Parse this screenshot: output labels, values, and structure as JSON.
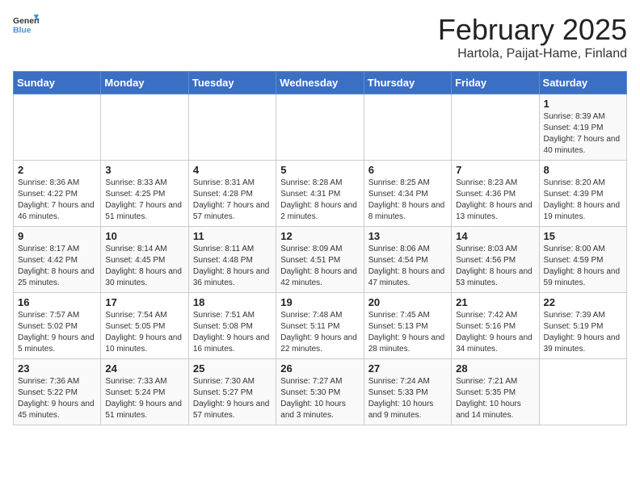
{
  "header": {
    "logo_general": "General",
    "logo_blue": "Blue",
    "month_year": "February 2025",
    "location": "Hartola, Paijat-Hame, Finland"
  },
  "days_of_week": [
    "Sunday",
    "Monday",
    "Tuesday",
    "Wednesday",
    "Thursday",
    "Friday",
    "Saturday"
  ],
  "weeks": [
    [
      {
        "day": "",
        "info": ""
      },
      {
        "day": "",
        "info": ""
      },
      {
        "day": "",
        "info": ""
      },
      {
        "day": "",
        "info": ""
      },
      {
        "day": "",
        "info": ""
      },
      {
        "day": "",
        "info": ""
      },
      {
        "day": "1",
        "info": "Sunrise: 8:39 AM\nSunset: 4:19 PM\nDaylight: 7 hours and 40 minutes."
      }
    ],
    [
      {
        "day": "2",
        "info": "Sunrise: 8:36 AM\nSunset: 4:22 PM\nDaylight: 7 hours and 46 minutes."
      },
      {
        "day": "3",
        "info": "Sunrise: 8:33 AM\nSunset: 4:25 PM\nDaylight: 7 hours and 51 minutes."
      },
      {
        "day": "4",
        "info": "Sunrise: 8:31 AM\nSunset: 4:28 PM\nDaylight: 7 hours and 57 minutes."
      },
      {
        "day": "5",
        "info": "Sunrise: 8:28 AM\nSunset: 4:31 PM\nDaylight: 8 hours and 2 minutes."
      },
      {
        "day": "6",
        "info": "Sunrise: 8:25 AM\nSunset: 4:34 PM\nDaylight: 8 hours and 8 minutes."
      },
      {
        "day": "7",
        "info": "Sunrise: 8:23 AM\nSunset: 4:36 PM\nDaylight: 8 hours and 13 minutes."
      },
      {
        "day": "8",
        "info": "Sunrise: 8:20 AM\nSunset: 4:39 PM\nDaylight: 8 hours and 19 minutes."
      }
    ],
    [
      {
        "day": "9",
        "info": "Sunrise: 8:17 AM\nSunset: 4:42 PM\nDaylight: 8 hours and 25 minutes."
      },
      {
        "day": "10",
        "info": "Sunrise: 8:14 AM\nSunset: 4:45 PM\nDaylight: 8 hours and 30 minutes."
      },
      {
        "day": "11",
        "info": "Sunrise: 8:11 AM\nSunset: 4:48 PM\nDaylight: 8 hours and 36 minutes."
      },
      {
        "day": "12",
        "info": "Sunrise: 8:09 AM\nSunset: 4:51 PM\nDaylight: 8 hours and 42 minutes."
      },
      {
        "day": "13",
        "info": "Sunrise: 8:06 AM\nSunset: 4:54 PM\nDaylight: 8 hours and 47 minutes."
      },
      {
        "day": "14",
        "info": "Sunrise: 8:03 AM\nSunset: 4:56 PM\nDaylight: 8 hours and 53 minutes."
      },
      {
        "day": "15",
        "info": "Sunrise: 8:00 AM\nSunset: 4:59 PM\nDaylight: 8 hours and 59 minutes."
      }
    ],
    [
      {
        "day": "16",
        "info": "Sunrise: 7:57 AM\nSunset: 5:02 PM\nDaylight: 9 hours and 5 minutes."
      },
      {
        "day": "17",
        "info": "Sunrise: 7:54 AM\nSunset: 5:05 PM\nDaylight: 9 hours and 10 minutes."
      },
      {
        "day": "18",
        "info": "Sunrise: 7:51 AM\nSunset: 5:08 PM\nDaylight: 9 hours and 16 minutes."
      },
      {
        "day": "19",
        "info": "Sunrise: 7:48 AM\nSunset: 5:11 PM\nDaylight: 9 hours and 22 minutes."
      },
      {
        "day": "20",
        "info": "Sunrise: 7:45 AM\nSunset: 5:13 PM\nDaylight: 9 hours and 28 minutes."
      },
      {
        "day": "21",
        "info": "Sunrise: 7:42 AM\nSunset: 5:16 PM\nDaylight: 9 hours and 34 minutes."
      },
      {
        "day": "22",
        "info": "Sunrise: 7:39 AM\nSunset: 5:19 PM\nDaylight: 9 hours and 39 minutes."
      }
    ],
    [
      {
        "day": "23",
        "info": "Sunrise: 7:36 AM\nSunset: 5:22 PM\nDaylight: 9 hours and 45 minutes."
      },
      {
        "day": "24",
        "info": "Sunrise: 7:33 AM\nSunset: 5:24 PM\nDaylight: 9 hours and 51 minutes."
      },
      {
        "day": "25",
        "info": "Sunrise: 7:30 AM\nSunset: 5:27 PM\nDaylight: 9 hours and 57 minutes."
      },
      {
        "day": "26",
        "info": "Sunrise: 7:27 AM\nSunset: 5:30 PM\nDaylight: 10 hours and 3 minutes."
      },
      {
        "day": "27",
        "info": "Sunrise: 7:24 AM\nSunset: 5:33 PM\nDaylight: 10 hours and 9 minutes."
      },
      {
        "day": "28",
        "info": "Sunrise: 7:21 AM\nSunset: 5:35 PM\nDaylight: 10 hours and 14 minutes."
      },
      {
        "day": "",
        "info": ""
      }
    ]
  ]
}
